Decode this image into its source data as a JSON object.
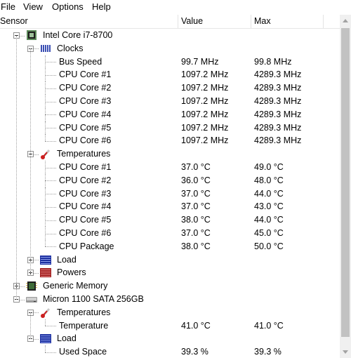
{
  "menu": [
    "File",
    "View",
    "Options",
    "Help"
  ],
  "columns": {
    "sensor": "Sensor",
    "value": "Value",
    "max": "Max"
  },
  "rows": [
    {
      "label": "Intel Core i7-8700",
      "value": "",
      "max": "",
      "level": 1,
      "icon": "cpu-chip-icon",
      "expander": "minus"
    },
    {
      "label": "Clocks",
      "value": "",
      "max": "",
      "level": 2,
      "icon": "clock-bars-icon",
      "expander": "minus"
    },
    {
      "label": "Bus Speed",
      "value": "99.7 MHz",
      "max": "99.8 MHz",
      "level": 3
    },
    {
      "label": "CPU Core #1",
      "value": "1097.2 MHz",
      "max": "4289.3 MHz",
      "level": 3
    },
    {
      "label": "CPU Core #2",
      "value": "1097.2 MHz",
      "max": "4289.3 MHz",
      "level": 3
    },
    {
      "label": "CPU Core #3",
      "value": "1097.2 MHz",
      "max": "4289.3 MHz",
      "level": 3
    },
    {
      "label": "CPU Core #4",
      "value": "1097.2 MHz",
      "max": "4289.3 MHz",
      "level": 3
    },
    {
      "label": "CPU Core #5",
      "value": "1097.2 MHz",
      "max": "4289.3 MHz",
      "level": 3
    },
    {
      "label": "CPU Core #6",
      "value": "1097.2 MHz",
      "max": "4289.3 MHz",
      "level": 3
    },
    {
      "label": "Temperatures",
      "value": "",
      "max": "",
      "level": 2,
      "icon": "thermometer-icon",
      "expander": "minus"
    },
    {
      "label": "CPU Core #1",
      "value": "37.0 °C",
      "max": "49.0 °C",
      "level": 3
    },
    {
      "label": "CPU Core #2",
      "value": "36.0 °C",
      "max": "48.0 °C",
      "level": 3
    },
    {
      "label": "CPU Core #3",
      "value": "37.0 °C",
      "max": "44.0 °C",
      "level": 3
    },
    {
      "label": "CPU Core #4",
      "value": "37.0 °C",
      "max": "43.0 °C",
      "level": 3
    },
    {
      "label": "CPU Core #5",
      "value": "38.0 °C",
      "max": "44.0 °C",
      "level": 3
    },
    {
      "label": "CPU Core #6",
      "value": "37.0 °C",
      "max": "45.0 °C",
      "level": 3
    },
    {
      "label": "CPU Package",
      "value": "38.0 °C",
      "max": "50.0 °C",
      "level": 3
    },
    {
      "label": "Load",
      "value": "",
      "max": "",
      "level": 2,
      "icon": "load-bars-icon",
      "expander": "plus"
    },
    {
      "label": "Powers",
      "value": "",
      "max": "",
      "level": 2,
      "icon": "power-bars-icon",
      "expander": "plus"
    },
    {
      "label": "Generic Memory",
      "value": "",
      "max": "",
      "level": 1,
      "icon": "memory-chip-icon",
      "expander": "plus"
    },
    {
      "label": "Micron 1100 SATA 256GB",
      "value": "",
      "max": "",
      "level": 1,
      "icon": "hard-drive-icon",
      "expander": "minus"
    },
    {
      "label": "Temperatures",
      "value": "",
      "max": "",
      "level": 2,
      "icon": "thermometer-icon",
      "expander": "minus"
    },
    {
      "label": "Temperature",
      "value": "41.0 °C",
      "max": "41.0 °C",
      "level": 3
    },
    {
      "label": "Load",
      "value": "",
      "max": "",
      "level": 2,
      "icon": "load-bars-icon",
      "expander": "minus"
    },
    {
      "label": "Used Space",
      "value": "39.3 %",
      "max": "39.3 %",
      "level": 3
    }
  ]
}
